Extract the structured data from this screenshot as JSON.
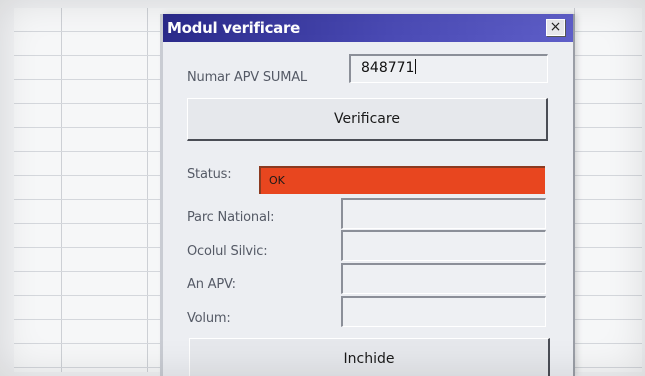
{
  "dialog": {
    "title": "Modul verificare",
    "close_glyph": "×",
    "apv": {
      "label": "Numar APV SUMAL",
      "value": "848771"
    },
    "verify_button": "Verificare",
    "status": {
      "label": "Status:",
      "value": "OK",
      "color": "#e8461f"
    },
    "fields": [
      {
        "label": "Parc National:",
        "value": ""
      },
      {
        "label": "Ocolul Silvic:",
        "value": ""
      },
      {
        "label": "An APV:",
        "value": ""
      },
      {
        "label": "Volum:",
        "value": ""
      }
    ],
    "close_button": "Inchide"
  },
  "colors": {
    "titlebar_start": "#2a2a8a",
    "titlebar_end": "#5e5ec8",
    "status_ok": "#e8461f"
  }
}
